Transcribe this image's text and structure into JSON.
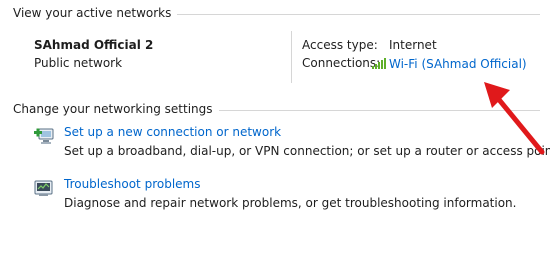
{
  "active_networks": {
    "header": "View your active networks",
    "network": {
      "name": "SAhmad Official  2",
      "category": "Public network"
    },
    "access_type_label": "Access type:",
    "access_type_value": "Internet",
    "connections_label": "Connections:",
    "connection_link": "Wi-Fi (SAhmad Official)"
  },
  "settings": {
    "header": "Change your networking settings",
    "tasks": [
      {
        "link": "Set up a new connection or network",
        "description": "Set up a broadband, dial-up, or VPN connection; or set up a router or access point.",
        "icon": "new-connection-icon"
      },
      {
        "link": "Troubleshoot problems",
        "description": "Diagnose and repair network problems, or get troubleshooting information.",
        "icon": "troubleshoot-icon"
      }
    ]
  },
  "colors": {
    "link": "#0066cc",
    "divider": "#d6d6d6",
    "signal": "#5faf28",
    "arrow": "#e0191b"
  }
}
